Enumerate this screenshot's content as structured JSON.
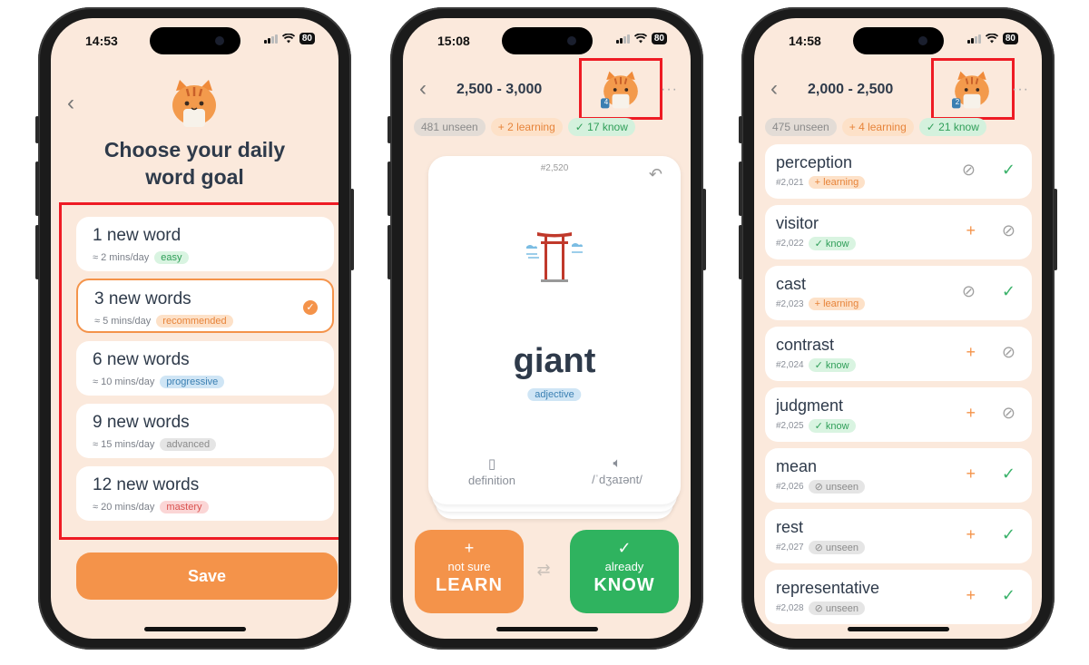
{
  "colors": {
    "accent": "#f4934a",
    "know_green": "#2fb35f",
    "screen_bg": "#fbe9dc",
    "highlight_red": "#ee1b24"
  },
  "phone1": {
    "time": "14:53",
    "battery": "80",
    "back_icon": "chevron-left-icon",
    "title": "Choose your daily word goal",
    "options": [
      {
        "label": "1 new word",
        "sub": "≈ 2 mins/day",
        "tag": "easy",
        "selected": false
      },
      {
        "label": "3 new words",
        "sub": "≈ 5 mins/day",
        "tag": "recommended",
        "selected": true
      },
      {
        "label": "6 new words",
        "sub": "≈ 10 mins/day",
        "tag": "progressive",
        "selected": false
      },
      {
        "label": "9 new words",
        "sub": "≈ 15 mins/day",
        "tag": "advanced",
        "selected": false
      },
      {
        "label": "12 new words",
        "sub": "≈ 20 mins/day",
        "tag": "mastery",
        "selected": false
      }
    ],
    "save_label": "Save"
  },
  "phone2": {
    "time": "15:08",
    "battery": "80",
    "title": "2,500 - 3,000",
    "avatar_badge": "4",
    "more": "···",
    "pills": {
      "unseen": "481 unseen",
      "learning": "+ 2 learning",
      "know": "✓ 17 know"
    },
    "card": {
      "number": "#2,520",
      "word": "giant",
      "pos": "adjective",
      "definition_label": "definition",
      "pronunciation": "/ˈdʒaɪənt/"
    },
    "learn": {
      "icon": "+",
      "small": "not sure",
      "big": "LEARN"
    },
    "know": {
      "icon": "✓",
      "small": "already",
      "big": "KNOW"
    },
    "swap_icon": "⇄"
  },
  "phone3": {
    "time": "14:58",
    "battery": "80",
    "title": "2,000 - 2,500",
    "avatar_badge": "2",
    "more": "···",
    "pills": {
      "unseen": "475 unseen",
      "learning": "+ 4 learning",
      "know": "✓ 21 know"
    },
    "words": [
      {
        "word": "perception",
        "num": "#2,021",
        "status": "+ learning",
        "status_type": "learning"
      },
      {
        "word": "visitor",
        "num": "#2,022",
        "status": "✓ know",
        "status_type": "know"
      },
      {
        "word": "cast",
        "num": "#2,023",
        "status": "+ learning",
        "status_type": "learning"
      },
      {
        "word": "contrast",
        "num": "#2,024",
        "status": "✓ know",
        "status_type": "know"
      },
      {
        "word": "judgment",
        "num": "#2,025",
        "status": "✓ know",
        "status_type": "know"
      },
      {
        "word": "mean",
        "num": "#2,026",
        "status": "unseen",
        "status_type": "unseen"
      },
      {
        "word": "rest",
        "num": "#2,027",
        "status": "unseen",
        "status_type": "unseen"
      },
      {
        "word": "representative",
        "num": "#2,028",
        "status": "unseen",
        "status_type": "unseen"
      }
    ]
  }
}
